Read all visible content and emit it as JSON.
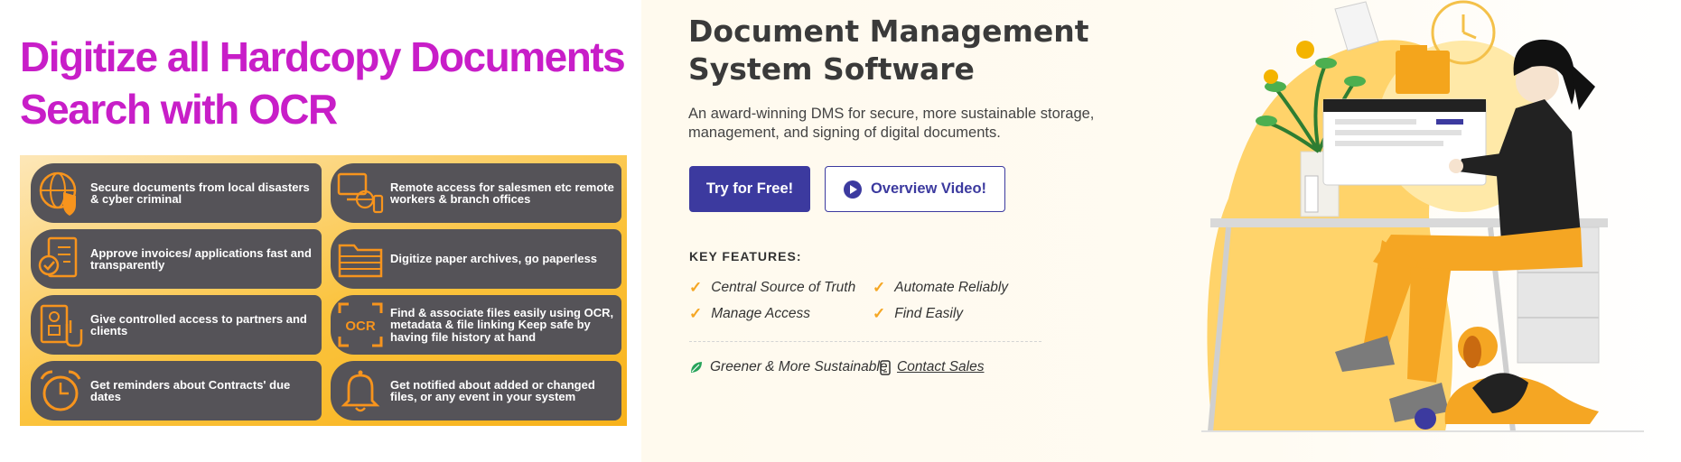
{
  "ad_panel": {
    "headline_line1": "Digitize all Hardcopy Documents",
    "headline_line2": "Search with OCR",
    "features": [
      {
        "icon": "shield-globe-icon",
        "text": "Secure documents from local disasters & cyber criminal"
      },
      {
        "icon": "remote-devices-icon",
        "text": "Remote access for salesmen etc remote workers & branch offices"
      },
      {
        "icon": "approved-document-icon",
        "text": "Approve invoices/ applications fast and transparently"
      },
      {
        "icon": "folder-icon",
        "text": "Digitize paper archives, go paperless"
      },
      {
        "icon": "access-control-icon",
        "text": "Give controlled access to partners and clients"
      },
      {
        "icon": "ocr-icon",
        "text": "Find & associate files easily using OCR, metadata & file linking Keep safe by having file history at hand"
      },
      {
        "icon": "alarm-clock-icon",
        "text": "Get reminders about Contracts' due dates"
      },
      {
        "icon": "bell-icon",
        "text": "Get notified about added or changed files, or any event in your system"
      }
    ],
    "ocr_badge": "OCR"
  },
  "hero": {
    "title_line1": "Document Management",
    "title_line2": "System Software",
    "subtitle": "An award-winning DMS for secure, more sustainable storage, management, and signing of digital documents.",
    "primary_cta": "Try for Free!",
    "secondary_cta": "Overview Video!",
    "key_features_title": "KEY FEATURES:",
    "key_features": [
      "Central Source of Truth",
      "Automate Reliably",
      "Manage Access",
      "Find Easily"
    ],
    "footer_greener": "Greener & More Sustainable",
    "footer_contact": "Contact Sales"
  },
  "colors": {
    "headline": "#c81ec8",
    "brand": "#3c3a9f",
    "accent": "#f5a623",
    "tile": "#555358"
  }
}
